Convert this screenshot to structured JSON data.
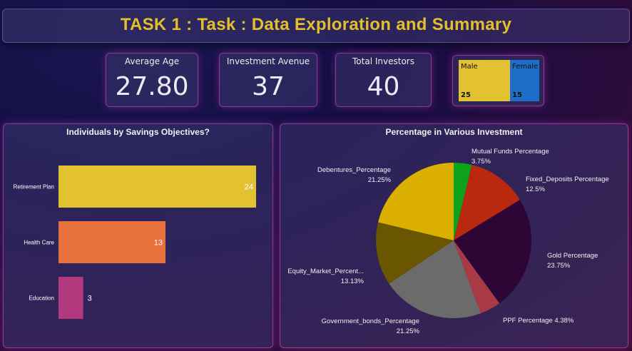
{
  "header": {
    "title": "TASK 1 : Task : Data Exploration and Summary"
  },
  "kpis": [
    {
      "label": "Average Age",
      "value": "27.80"
    },
    {
      "label": "Investment Avenue",
      "value": "37"
    },
    {
      "label": "Total Investors",
      "value": "40"
    }
  ],
  "gender": {
    "male_label": "Male",
    "male_count": "25",
    "male_color": "#e3c231",
    "female_label": "Female",
    "female_count": "15",
    "female_color": "#1e6dc8"
  },
  "chart_data": [
    {
      "type": "bar",
      "orientation": "horizontal",
      "title": "Individuals by Savings Objectives?",
      "categories": [
        "Retirement Plan",
        "Health Care",
        "Education"
      ],
      "values": [
        24,
        13,
        3
      ],
      "colors": [
        "#e3c231",
        "#e8703a",
        "#b2397e"
      ]
    },
    {
      "type": "pie",
      "title": "Percentage in Various Investment",
      "slices": [
        {
          "label": "Mutual Funds Percentage",
          "pct_label": "3.75%",
          "value": 3.75,
          "color": "#0ea11a"
        },
        {
          "label": "Fixed_Deposits Percentage",
          "pct_label": "12.5%",
          "value": 12.5,
          "color": "#b8290f"
        },
        {
          "label": "Gold Percentage",
          "pct_label": "23.75%",
          "value": 23.75,
          "color": "#2e0636"
        },
        {
          "label": "PPF Percentage",
          "pct_label": "4.38%",
          "value": 4.38,
          "color": "#a83a46"
        },
        {
          "label": "Government_bonds_Percentage",
          "pct_label": "21.25%",
          "value": 21.25,
          "color": "#6b6b6b"
        },
        {
          "label": "Equity_Market_Percent...",
          "pct_label": "13.13%",
          "value": 13.13,
          "color": "#6a5500"
        },
        {
          "label": "Debentures_Percentage",
          "pct_label": "21.25%",
          "value": 21.25,
          "color": "#dcb000"
        }
      ]
    }
  ]
}
